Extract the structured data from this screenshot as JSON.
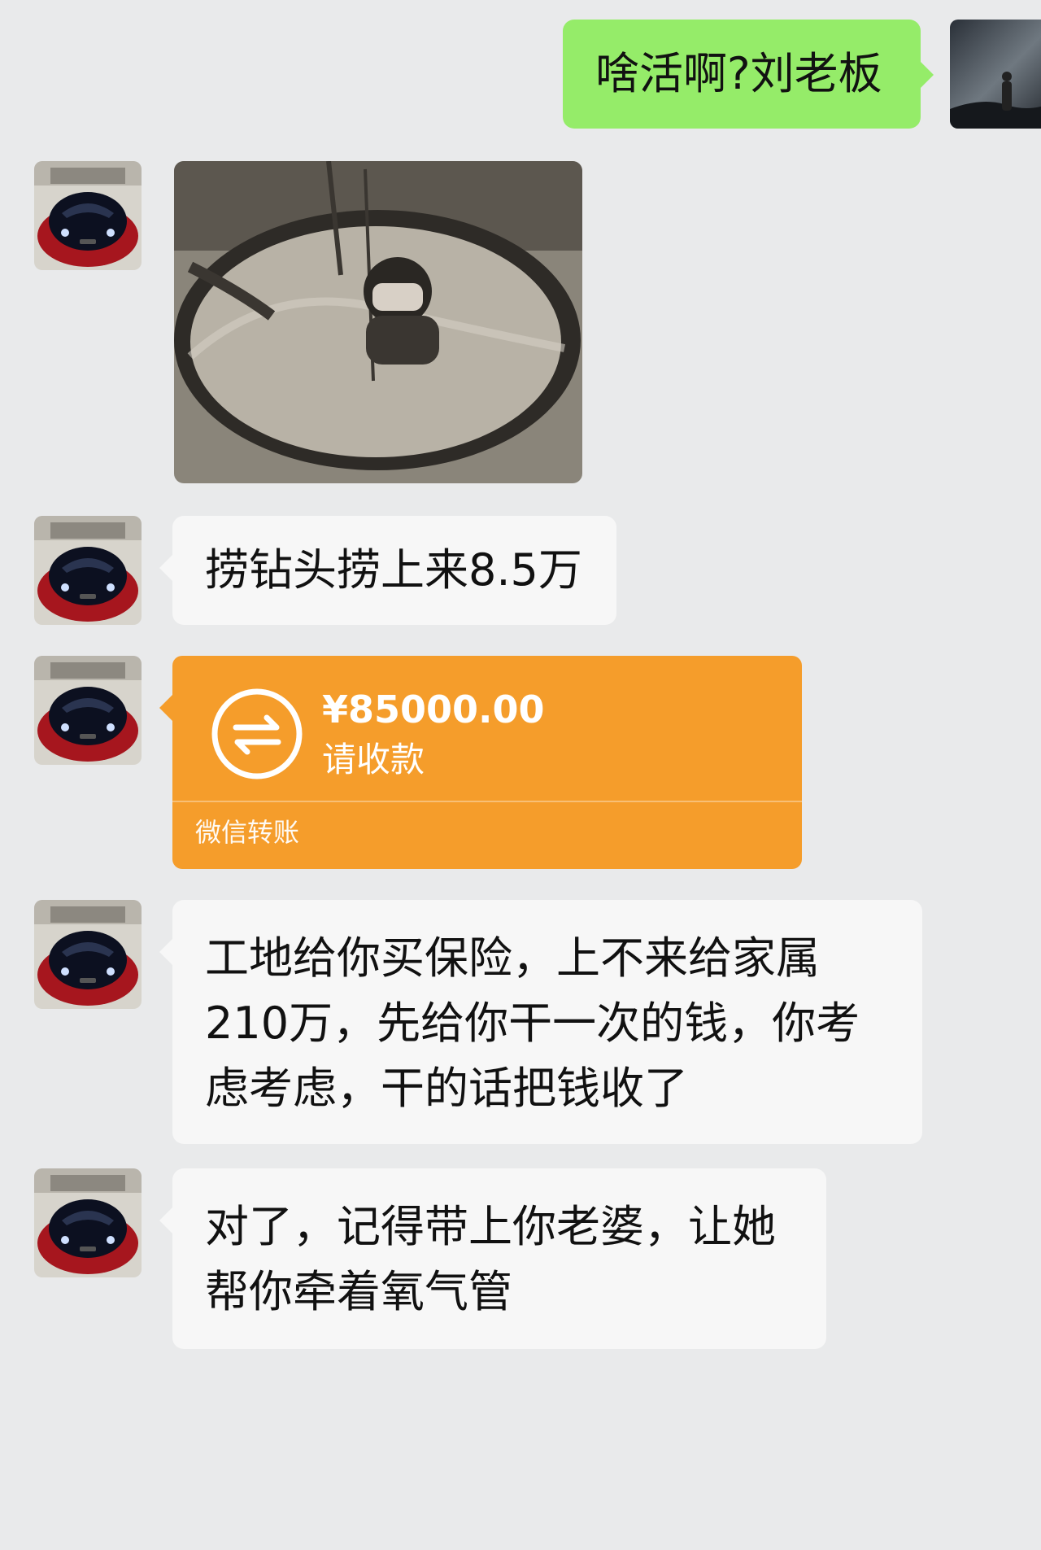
{
  "messages": {
    "outgoing_1": "啥活啊?刘老板",
    "incoming_text_1": "捞钻头捞上来8.5万",
    "transfer": {
      "amount": "¥85000.00",
      "note": "请收款",
      "footer": "微信转账"
    },
    "incoming_text_2_lines": [
      "工地给你买保险，上不来给家属",
      "210万，先给你干一次的钱，你考",
      "虑考虑，干的话把钱收了"
    ],
    "incoming_text_3_lines": [
      "对了，记得带上你老婆，让她",
      "帮你牵着氧气管"
    ]
  },
  "colors": {
    "background": "#e9eaeb",
    "outgoing_bubble": "#95ec69",
    "incoming_bubble": "#f7f7f7",
    "transfer_card": "#f59d2b"
  },
  "icons": [
    "car-avatar",
    "person-avatar",
    "transfer-arrows-icon",
    "diver-photo"
  ]
}
